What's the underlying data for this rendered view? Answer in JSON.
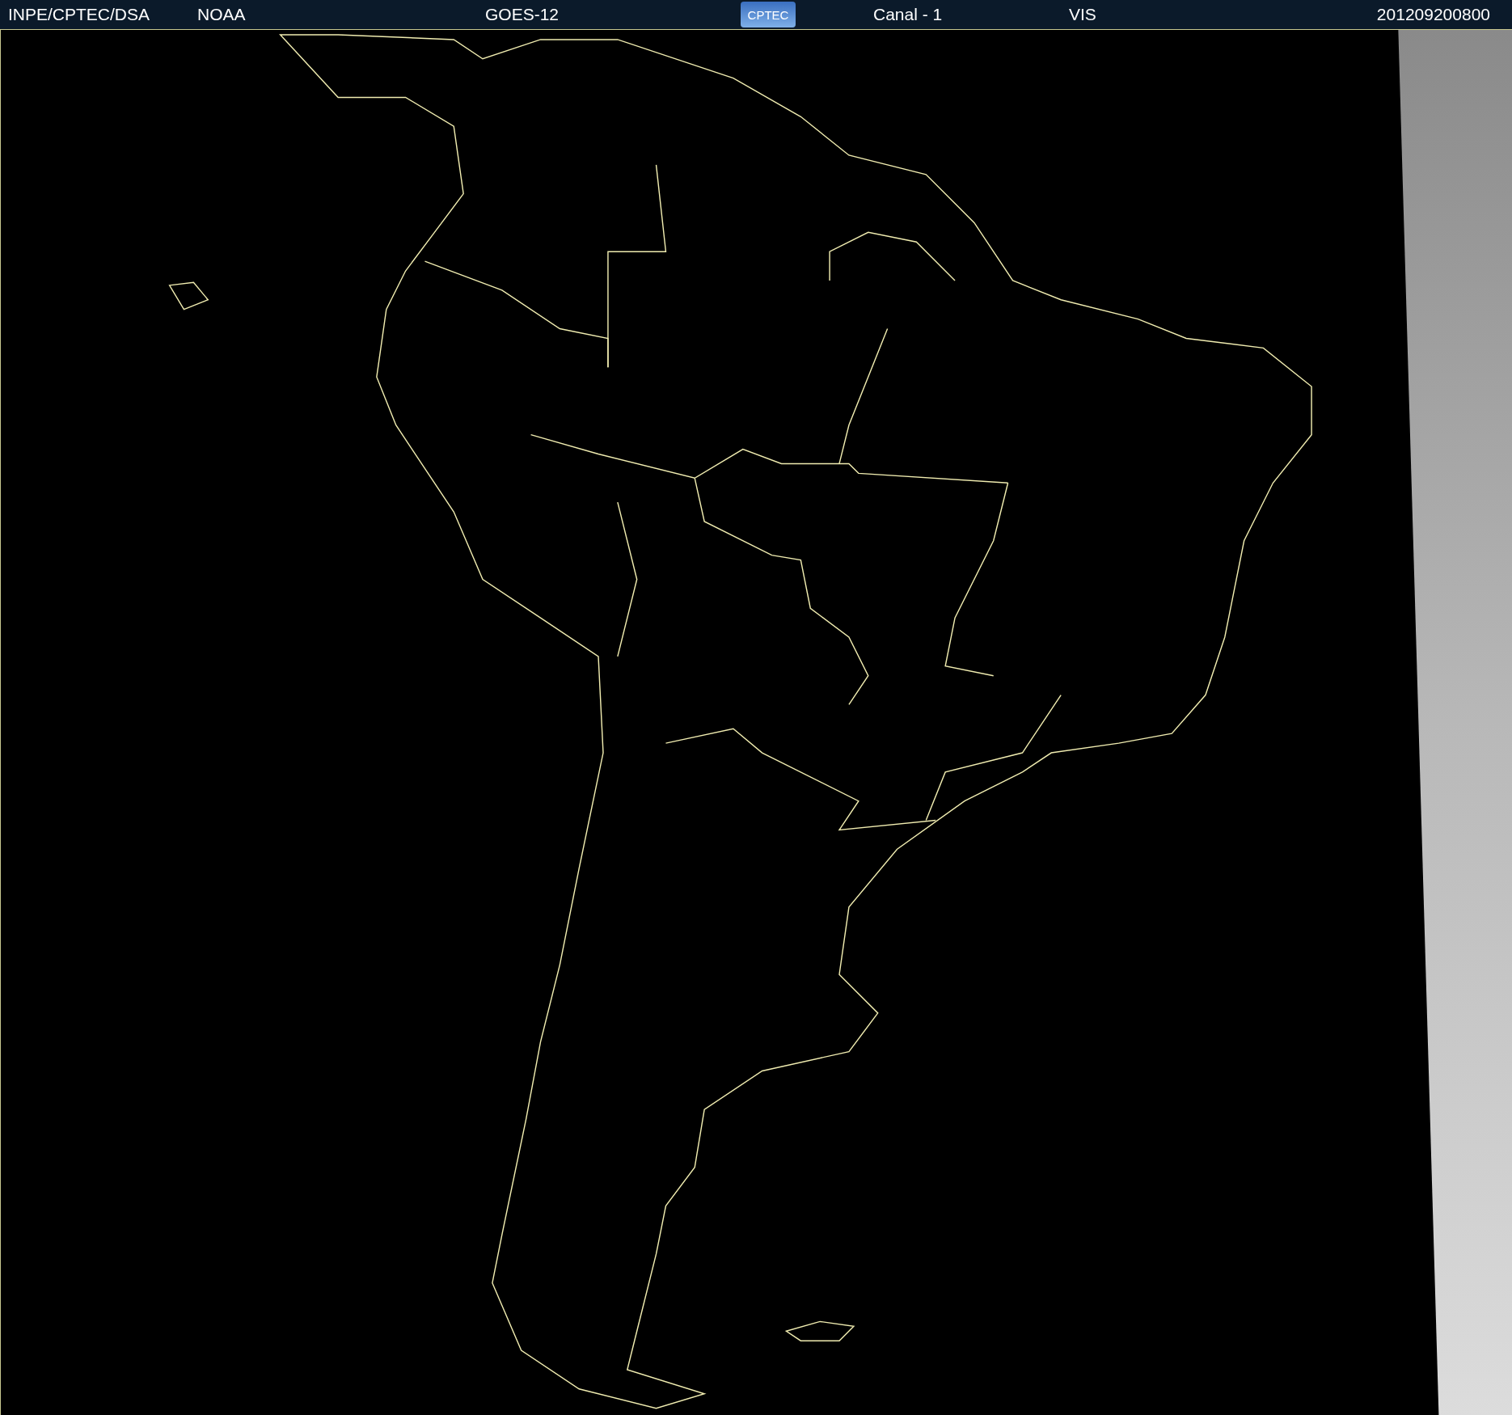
{
  "header": {
    "agency": "INPE/CPTEC/DSA",
    "provider": "NOAA",
    "satellite": "GOES-12",
    "logo": "CPTEC",
    "channel": "Canal - 1",
    "band": "VIS",
    "timestamp": "201209200800"
  }
}
